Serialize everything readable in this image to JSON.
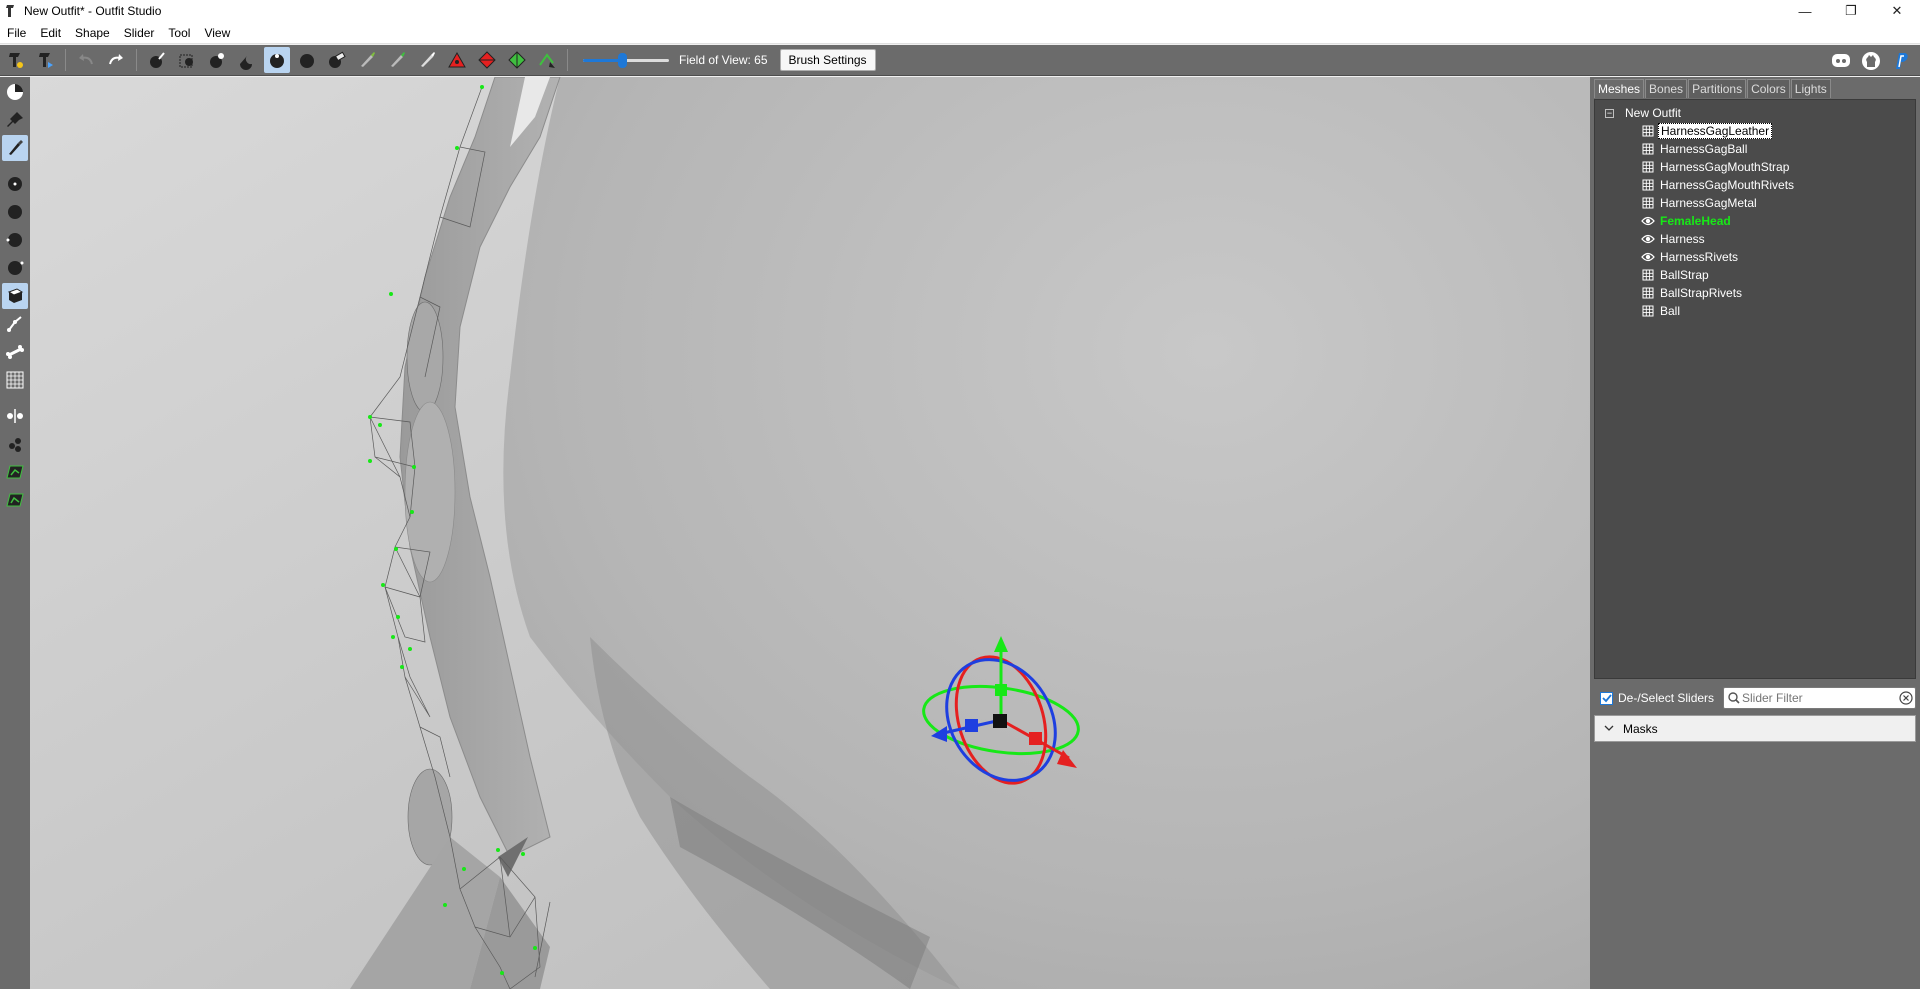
{
  "window": {
    "title": "New Outfit* - Outfit Studio",
    "controls": {
      "minimize": "—",
      "restore": "❐",
      "close": "✕"
    }
  },
  "menu": [
    "File",
    "Edit",
    "Shape",
    "Slider",
    "Tool",
    "View"
  ],
  "toolbar": {
    "fov_label": "Field of View: 65",
    "fov_value": 65,
    "fov_fraction": 0.45,
    "brush_settings": "Brush Settings",
    "icons": [
      "new-project-icon",
      "load-outfit-icon",
      "undo-icon",
      "redo-icon",
      "inflate-brush-icon",
      "mask-brush-icon",
      "deflate-brush-icon",
      "move-brush-icon",
      "smooth-brush-icon",
      "undiff-brush-icon",
      "erase-icon",
      "color-brush-icon",
      "alpha-brush-icon",
      "weight-brush-icon",
      "triangle-collapse-icon",
      "flip-edge-icon",
      "split-edge-icon",
      "delete-vertex-icon"
    ],
    "right_icons": [
      "discord-icon",
      "github-icon",
      "paypal-icon"
    ]
  },
  "left_tools": [
    "select-tool-icon",
    "pin-tool-icon",
    "brush-tool-icon",
    "brush-size-small-icon",
    "brush-size-medium-icon",
    "brush-size-large-icon",
    "brush-strength-icon",
    "transform-icon",
    "pivot-icon",
    "bone-icon",
    "wireframe-grid-icon",
    "mirror-icon",
    "vertex-select-icon",
    "connected-only-icon",
    "collision-icon"
  ],
  "tabs": [
    "Meshes",
    "Bones",
    "Partitions",
    "Colors",
    "Lights"
  ],
  "tree": {
    "root": "New Outfit",
    "expander": "−",
    "nodes": [
      {
        "label": "HarnessGagLeather",
        "icon": "mesh-grid-icon",
        "state": "selected"
      },
      {
        "label": "HarnessGagBall",
        "icon": "mesh-grid-icon",
        "state": "normal"
      },
      {
        "label": "HarnessGagMouthStrap",
        "icon": "mesh-grid-icon",
        "state": "normal"
      },
      {
        "label": "HarnessGagMouthRivets",
        "icon": "mesh-grid-icon",
        "state": "normal"
      },
      {
        "label": "HarnessGagMetal",
        "icon": "mesh-grid-icon",
        "state": "normal"
      },
      {
        "label": "FemaleHead",
        "icon": "eye-icon",
        "state": "highlight"
      },
      {
        "label": "Harness",
        "icon": "eye-icon",
        "state": "normal"
      },
      {
        "label": "HarnessRivets",
        "icon": "eye-icon",
        "state": "normal"
      },
      {
        "label": "BallStrap",
        "icon": "mesh-grid-icon",
        "state": "normal"
      },
      {
        "label": "BallStrapRivets",
        "icon": "mesh-grid-icon",
        "state": "normal"
      },
      {
        "label": "Ball",
        "icon": "mesh-grid-icon",
        "state": "normal"
      }
    ]
  },
  "sliders": {
    "toggle_label": "De-/Select Sliders",
    "toggle_checked": true,
    "filter_placeholder": "Slider Filter",
    "masks_label": "Masks"
  },
  "colors": {
    "toolbar_bg": "#6b6b6b",
    "tree_bg": "#4b4b4b",
    "highlight_green": "#17e817",
    "accent_blue": "#1e78d7",
    "viewport_bg": "#d9d9d9"
  }
}
